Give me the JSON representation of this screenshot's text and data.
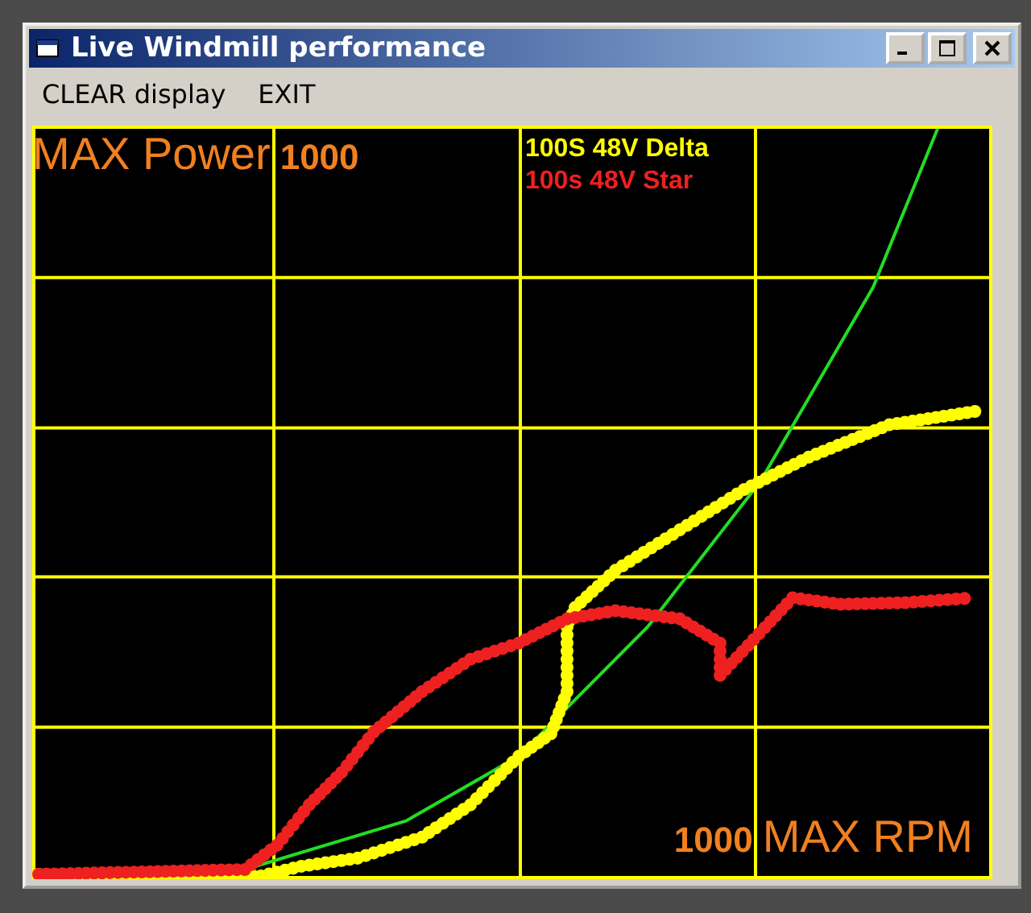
{
  "window": {
    "title": "Live Windmill performance"
  },
  "menu": [
    {
      "label": "CLEAR display"
    },
    {
      "label": "EXIT"
    }
  ],
  "plot": {
    "power_label": "MAX Power",
    "power_value": "1000",
    "rpm_value": "1000",
    "rpm_label": "MAX RPM",
    "legend": [
      {
        "label": "100S 48V Delta",
        "color": "#ffff00"
      },
      {
        "label": "100s 48V Star",
        "color": "#ee2020"
      }
    ]
  }
}
